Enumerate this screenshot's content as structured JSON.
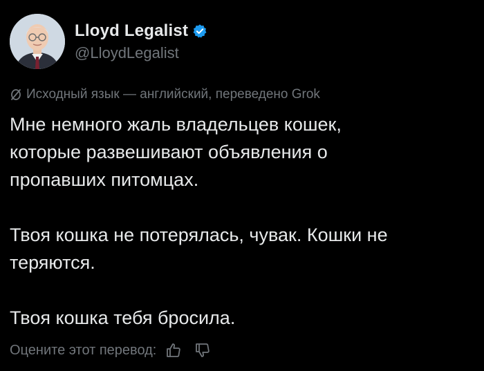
{
  "author": {
    "display_name": "Lloyd Legalist",
    "handle": "@LloydLegalist",
    "verified": true,
    "accent_color": "#1d9bf0"
  },
  "translation": {
    "note": "Исходный язык — английский, переведено Grok",
    "icon": "translate-icon"
  },
  "tweet": {
    "text": "Мне немного жаль владельцев кошек,\nкоторые развешивают объявления о\nпропавших питомцах.\n\nТвоя кошка не потерялась, чувак. Кошки не\nтеряются.\n\nТвоя кошка тебя бросила."
  },
  "rating": {
    "label": "Оцените этот перевод:",
    "thumbs_up_icon": "thumbs-up-icon",
    "thumbs_down_icon": "thumbs-down-icon"
  },
  "colors": {
    "background": "#000000",
    "text_primary": "#e7e9ea",
    "text_secondary": "#71767b"
  }
}
